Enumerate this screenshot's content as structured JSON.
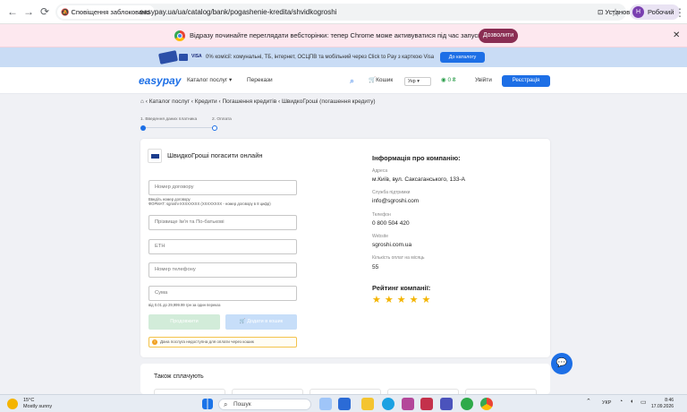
{
  "browser": {
    "lock_label": "Сповіщення заблоковано",
    "url": "easypay.ua/ua/catalog/bank/pogashenie-kredita/shvidkogroshi",
    "install_label": "Установити",
    "profile_label": "Робочий",
    "profile_initial": "Н"
  },
  "infobar": {
    "text": "Відразу починайте переглядати вебсторінки: тепер Chrome може активуватися під час запуску Windows.",
    "button": "Дозволити"
  },
  "promo": {
    "text": "0% комісії: комунальні, ТБ, інтернет, ОСЦПВ та мобільний через Click to Pay з карткою Visa",
    "button": "До каталогу"
  },
  "header": {
    "logo": "easypay",
    "catalog": "Каталог послуг",
    "transfers": "Перекази",
    "cart": "Кошик",
    "lang": "Укр",
    "balance": "0 ₴",
    "login": "Увійти",
    "register": "Реєстрація"
  },
  "breadcrumb": [
    "Каталог послуг",
    "Кредити",
    "Погашення кредитів",
    "ШвидкоГроші (погашення кредиту)"
  ],
  "steps": {
    "step1": "1. Введення даних платника",
    "step2": "2. Оплата"
  },
  "form": {
    "title": "ШвидкоГроші погасити онлайн",
    "contract_placeholder": "Номер договору",
    "contract_hint1": "Введіть номер договору",
    "contract_hint2": "ФОРМАТ: sgroshi-XXXXXXXX (ХХХХХХХХ - номер договору в 8 цифр)",
    "name_placeholder": "Прізвище Ім'я та По-батькові",
    "tax_placeholder": "ЕТН",
    "phone_placeholder": "Номер телефону",
    "amount_placeholder": "Сума",
    "amount_hint": "від 0.01 до 29,999.99 грн за один переказ",
    "next_button": "Продовжити",
    "cart_button": "Додати в кошик",
    "warning": "Дана послуга недоступна для оплати через кошик"
  },
  "company": {
    "heading": "Інформація про компанію:",
    "address_label": "Адреса",
    "address": "м.Київ, вул. Саксаганського, 133-А",
    "support_label": "Служба підтримки",
    "support": "info@sgroshi.com",
    "phone_label": "Телефон",
    "phone": "0 800 504 420",
    "website_label": "Website",
    "website": "sgroshi.com.ua",
    "payments_label": "Кількість оплат на місяць",
    "payments": "55",
    "rating_heading": "Рейтинг компанії:",
    "rating": 5,
    "stars": "★★★★★"
  },
  "also": {
    "title": "Також сплачують"
  },
  "taskbar": {
    "temp": "15°C",
    "weather": "Mostly sunny",
    "search": "Пошук",
    "lang": "УКР",
    "time": "8:46",
    "date": "17.09.2026"
  }
}
